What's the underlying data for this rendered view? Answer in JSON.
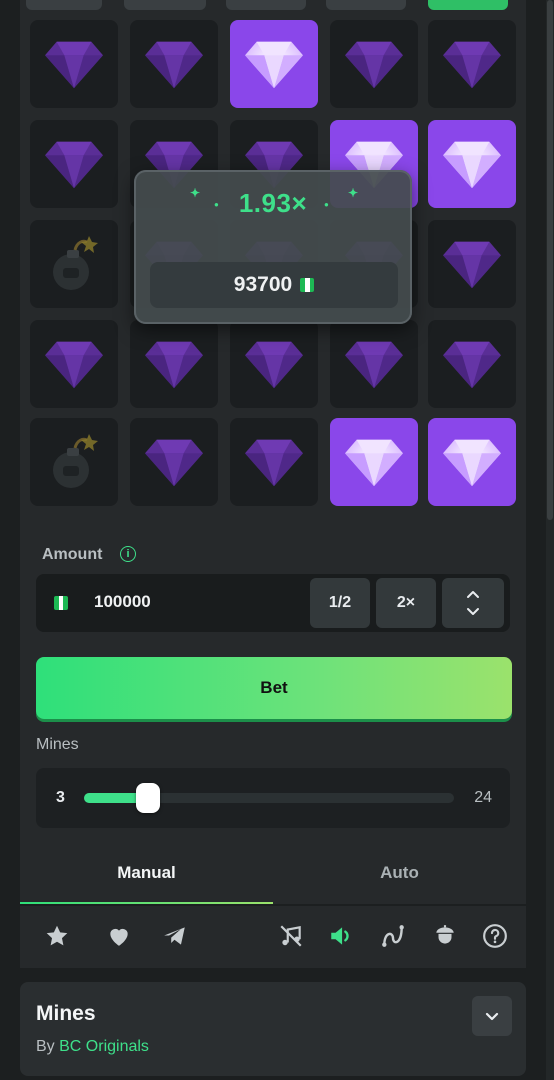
{
  "grid": {
    "rows": [
      [
        "gem",
        "gem",
        "gem-revealed",
        "gem",
        "gem"
      ],
      [
        "gem",
        "gem",
        "gem",
        "gem-revealed",
        "gem-revealed"
      ],
      [
        "bomb",
        "gem",
        "gem",
        "gem",
        "gem"
      ],
      [
        "gem",
        "gem",
        "gem",
        "gem",
        "gem"
      ],
      [
        "bomb",
        "gem",
        "gem",
        "gem-revealed",
        "gem-revealed"
      ]
    ]
  },
  "win_popup": {
    "multiplier": "1.93×",
    "payout": "93700"
  },
  "bet_panel": {
    "amount_label": "Amount",
    "amount_value": "100000",
    "half_label": "1/2",
    "double_label": "2×",
    "bet_label": "Bet",
    "mines_label": "Mines",
    "mines_min": "3",
    "mines_max": "24",
    "mines_value": 3
  },
  "tabs": [
    {
      "label": "Manual",
      "active": true
    },
    {
      "label": "Auto",
      "active": false
    }
  ],
  "toolbar": {
    "icons": [
      "star-icon",
      "heart-icon",
      "send-icon",
      "music-off-icon",
      "sound-on-icon",
      "chart-curve-icon",
      "acorn-icon",
      "help-icon"
    ]
  },
  "game_info": {
    "title": "Mines",
    "by_label": "By",
    "provider": "BC Originals"
  },
  "colors": {
    "accent_green": "#3ee08a",
    "gem_revealed_bg": "#8a47ea",
    "tile_bg": "#1b1e20"
  }
}
